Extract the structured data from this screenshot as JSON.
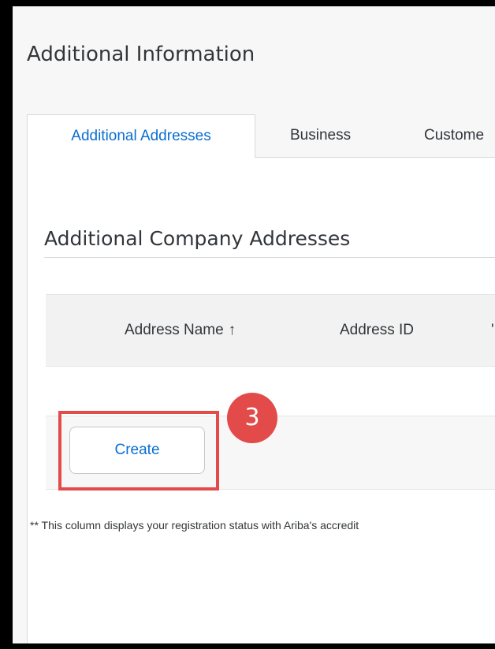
{
  "page": {
    "title": "Additional Information"
  },
  "tabs": [
    {
      "label": "Additional Addresses",
      "active": true
    },
    {
      "label": "Business",
      "active": false
    },
    {
      "label": "Custome",
      "active": false
    }
  ],
  "section": {
    "title": "Additional Company Addresses"
  },
  "table": {
    "columns": [
      {
        "label": "Address Name",
        "sort": "ascending",
        "sort_glyph": "↑"
      },
      {
        "label": "Address ID"
      },
      {
        "label": "'"
      }
    ]
  },
  "actions": {
    "create_label": "Create"
  },
  "annotation": {
    "step_number": "3",
    "color": "#e34b4b"
  },
  "footnote": "** This column displays your registration status with Ariba's accredit",
  "colors": {
    "accent": "#0a6ed1",
    "text": "#32363a",
    "highlight": "#e34b4b"
  }
}
